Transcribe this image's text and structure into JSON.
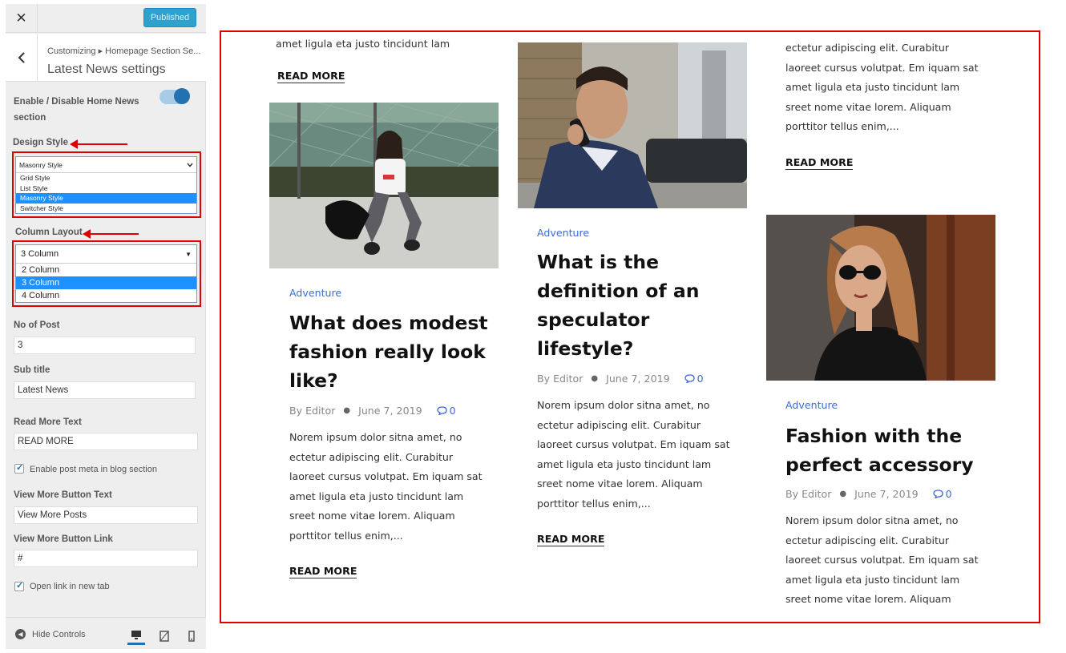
{
  "sidebar": {
    "close_icon": "close-icon",
    "publish_label": "Published",
    "breadcrumb": "Customizing ▸ Homepage Section Se...",
    "panel_title": "Latest News settings",
    "toggle_label": "Enable / Disable Home News section",
    "toggle_on": true,
    "design_style": {
      "label": "Design Style",
      "selected": "Masonry Style",
      "options": [
        "Grid Style",
        "List Style",
        "Masonry Style",
        "Switcher Style"
      ]
    },
    "column_layout": {
      "label": "Column Layout",
      "selected": "3 Column",
      "options": [
        "2 Column",
        "3 Column",
        "4 Column"
      ]
    },
    "no_of_post": {
      "label": "No of Post",
      "value": "3"
    },
    "sub_title": {
      "label": "Sub title",
      "value": "Latest News"
    },
    "read_more_text": {
      "label": "Read More Text",
      "value": "READ MORE"
    },
    "post_meta_checkbox": "Enable post meta in blog section",
    "view_more_text": {
      "label": "View More Button Text",
      "value": "View More Posts"
    },
    "view_more_link": {
      "label": "View More Button Link",
      "value": "#"
    },
    "new_tab_checkbox": "Open link in new tab",
    "hide_controls": "Hide Controls"
  },
  "preview": {
    "col1_top_text": "amet ligula eta justo tincidunt lam",
    "col1_read_more": "READ MORE",
    "col3_top_lines": [
      "ectetur adipiscing elit. Curabitur",
      "laoreet cursus volutpat. Em iquam sat",
      "amet ligula eta justo tincidunt lam",
      "sreet nome vitae lorem. Aliquam",
      "porttitor tellus enim,..."
    ],
    "col3_top_read_more": "READ MORE",
    "posts": [
      {
        "category": "Adventure",
        "title_lines": [
          "What does modest",
          "fashion really look",
          "like?"
        ],
        "author": "By Editor",
        "date": "June 7, 2019",
        "comments": "0",
        "excerpt_lines": [
          "Norem ipsum dolor sitna amet, no",
          "ectetur adipiscing elit. Curabitur",
          "laoreet cursus volutpat. Em iquam sat",
          "amet ligula eta justo tincidunt lam",
          "sreet nome vitae lorem. Aliquam",
          "porttitor tellus enim,..."
        ],
        "read_more": "READ MORE"
      },
      {
        "category": "Adventure",
        "title_lines": [
          "What is the",
          "definition of an",
          "speculator",
          "lifestyle?"
        ],
        "author": "By Editor",
        "date": "June 7, 2019",
        "comments": "0",
        "excerpt_lines": [
          "Norem ipsum dolor sitna amet, no",
          "ectetur adipiscing elit. Curabitur",
          "laoreet cursus volutpat. Em iquam sat",
          "amet ligula eta justo tincidunt lam",
          "sreet nome vitae lorem. Aliquam",
          "porttitor tellus enim,..."
        ],
        "read_more": "READ MORE"
      },
      {
        "category": "Adventure",
        "title_lines": [
          "Fashion with the",
          "perfect accessory"
        ],
        "author": "By Editor",
        "date": "June 7, 2019",
        "comments": "0",
        "excerpt_lines": [
          "Norem ipsum dolor sitna amet, no",
          "ectetur adipiscing elit. Curabitur",
          "laoreet cursus volutpat. Em iquam sat",
          "amet ligula eta justo tincidunt lam",
          "sreet nome vitae lorem. Aliquam"
        ]
      }
    ]
  },
  "colors": {
    "accent_blue": "#2271b1",
    "publish_button": "#2ea2cc",
    "annotation_red": "#e00000",
    "category_link": "#3d6bd6"
  }
}
